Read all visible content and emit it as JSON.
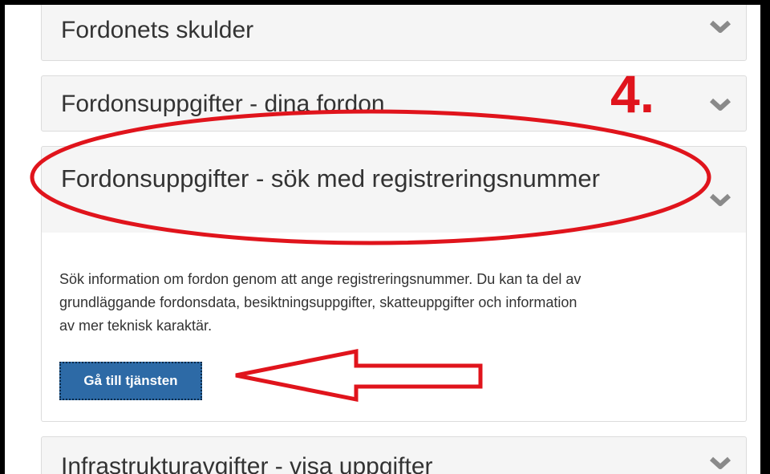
{
  "panels": {
    "skulder": {
      "title": "Fordonets skulder"
    },
    "dina_fordon": {
      "title": "Fordonsuppgifter - dina fordon"
    },
    "sok": {
      "title": "Fordonsuppgifter - sök med registreringsnummer",
      "description_lines": [
        "Sök information om fordon genom att ange registreringsnummer. Du kan ta del av",
        "grundläggande fordonsdata, besiktningsuppgifter, skatteuppgifter och information",
        "av mer teknisk karaktär."
      ],
      "button_label": "Gå till tjänsten"
    },
    "infrastruktur": {
      "title": "Infrastrukturavgifter - visa uppgifter"
    }
  },
  "annotation": {
    "step_label": "4.",
    "color": "#e0141c"
  },
  "colors": {
    "button_bg": "#2d6aa6",
    "panel_bg": "#f5f5f5",
    "chevron": "#8a8a8a"
  },
  "icons": {
    "chevron": "chevron-down-icon",
    "arrow": "arrow-left-annotation"
  }
}
